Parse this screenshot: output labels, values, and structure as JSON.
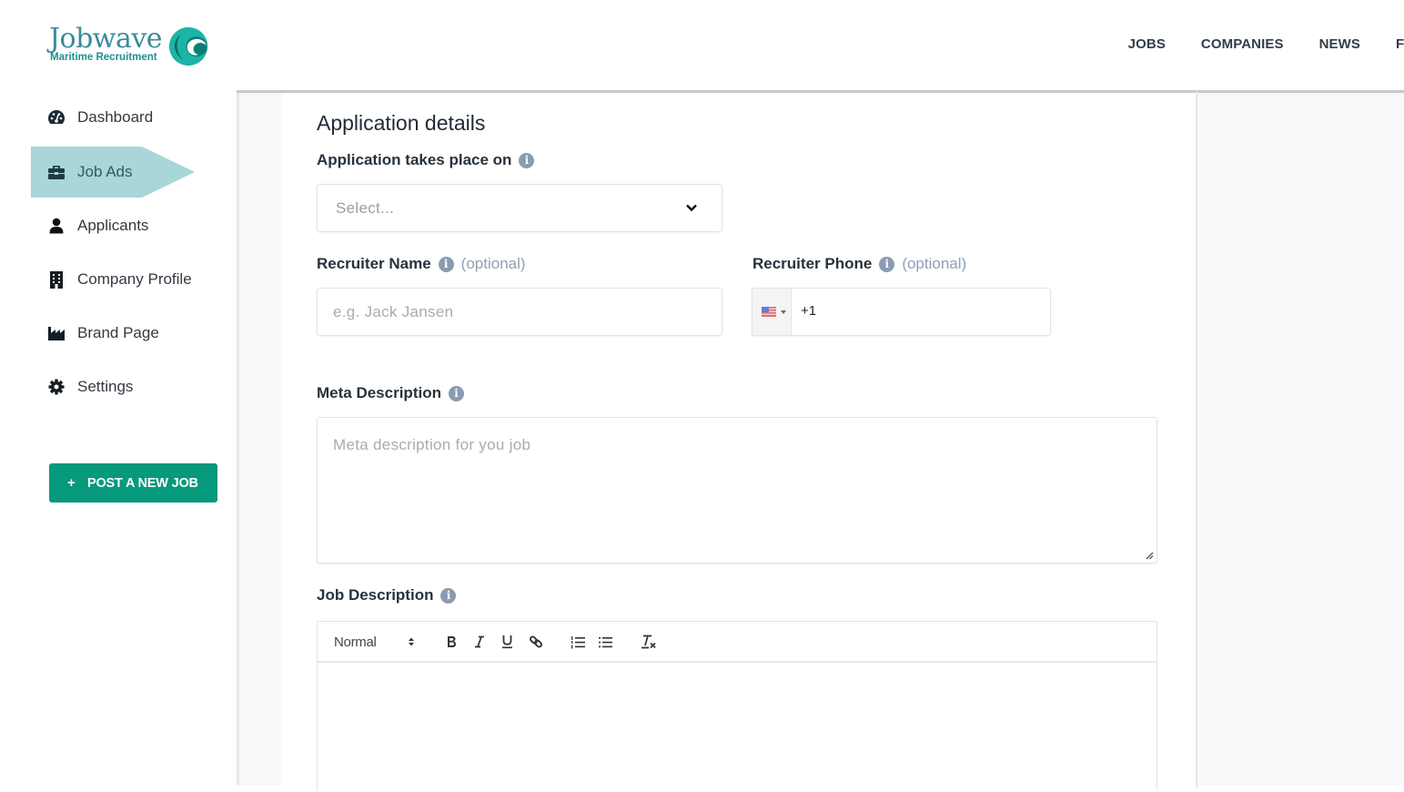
{
  "header": {
    "logo": {
      "wordmark": "Jobwave",
      "tagline": "Maritime Recruitment",
      "colors": {
        "primary": "#3b8a9a",
        "wave_dark": "#0b7e78",
        "wave_light": "#1cb5a5"
      }
    },
    "nav": [
      {
        "label": "JOBS"
      },
      {
        "label": "COMPANIES"
      },
      {
        "label": "NEWS"
      },
      {
        "label": "FO"
      }
    ]
  },
  "sidebar": {
    "items": [
      {
        "label": "Dashboard",
        "icon": "tachometer-icon",
        "active": false
      },
      {
        "label": "Job Ads",
        "icon": "briefcase-icon",
        "active": true
      },
      {
        "label": "Applicants",
        "icon": "user-icon",
        "active": false
      },
      {
        "label": "Company Profile",
        "icon": "building-icon",
        "active": false
      },
      {
        "label": "Brand Page",
        "icon": "industry-icon",
        "active": false
      },
      {
        "label": "Settings",
        "icon": "gear-icon",
        "active": false
      }
    ],
    "post_button": {
      "icon": "+",
      "label": "POST A NEW JOB"
    },
    "active_color": "#a8d6d9",
    "button_color": "#06997c"
  },
  "form": {
    "section_title": "Application details",
    "application_platform": {
      "label": "Application takes place on",
      "placeholder": "Select...",
      "value": ""
    },
    "recruiter_name": {
      "label": "Recruiter Name",
      "optional": "(optional)",
      "placeholder": "e.g. Jack Jansen",
      "value": ""
    },
    "recruiter_phone": {
      "label": "Recruiter Phone",
      "optional": "(optional)",
      "country": "US",
      "value": "+1"
    },
    "meta_description": {
      "label": "Meta Description",
      "placeholder": "Meta description for you job",
      "value": ""
    },
    "job_description": {
      "label": "Job Description",
      "toolbar": {
        "format_select": "Normal",
        "buttons": [
          "bold",
          "italic",
          "underline",
          "link",
          "ordered-list",
          "bullet-list",
          "clear-format"
        ]
      },
      "value": ""
    },
    "info_glyph": "i"
  }
}
